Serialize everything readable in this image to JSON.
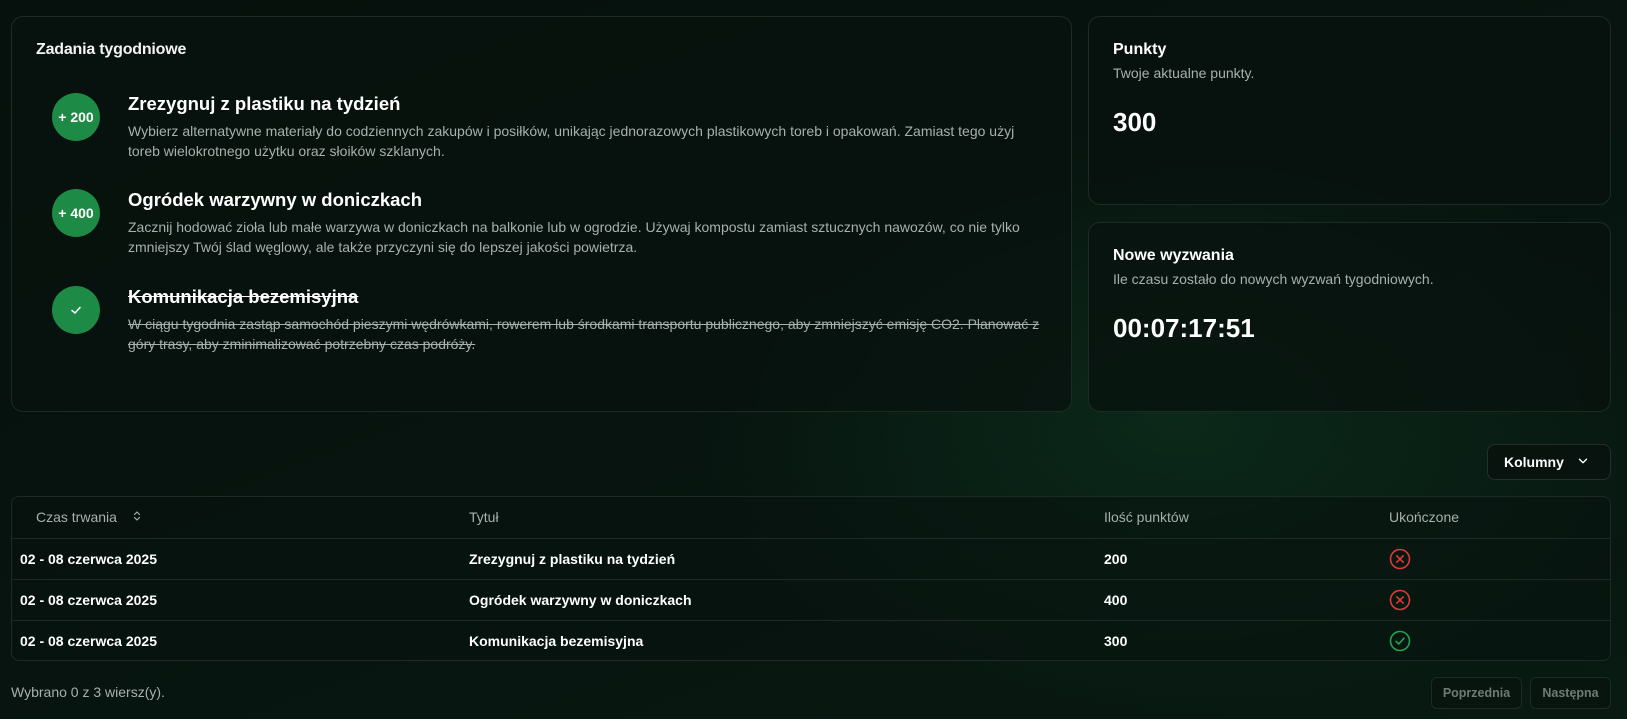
{
  "weekly_tasks": {
    "title": "Zadania tygodniowe",
    "items": [
      {
        "badge": "+ 200",
        "title": "Zrezygnuj z plastiku na tydzień",
        "description": "Wybierz alternatywne materiały do codziennych zakupów i posiłków, unikając jednorazowych plastikowych toreb i opakowań. Zamiast tego użyj toreb wielokrotnego użytku oraz słoików szklanych.",
        "completed": false
      },
      {
        "badge": "+ 400",
        "title": "Ogródek warzywny w doniczkach",
        "description": "Zacznij hodować zioła lub małe warzywa w doniczkach na balkonie lub w ogrodzie. Używaj kompostu zamiast sztucznych nawozów, co nie tylko zmniejszy Twój ślad węglowy, ale także przyczyni się do lepszej jakości powietrza.",
        "completed": false
      },
      {
        "badge_icon": "check-icon",
        "title": "Komunikacja bezemisyjna",
        "description": "W ciągu tygodnia zastąp samochód pieszymi wędrówkami, rowerem lub środkami transportu publicznego, aby zmniejszyć emisję CO2. Planować z góry trasy, aby zminimalizować potrzebny czas podróży.",
        "completed": true
      }
    ]
  },
  "points": {
    "title": "Punkty",
    "subtitle": "Twoje aktualne punkty.",
    "value": "300"
  },
  "new_challenges": {
    "title": "Nowe wyzwania",
    "subtitle": "Ile czasu zostało do nowych wyzwań tygodniowych.",
    "countdown": "00:07:17:51"
  },
  "columns_button": {
    "label": "Kolumny",
    "icon": "chevron-down-icon"
  },
  "table": {
    "headers": {
      "duration": "Czas trwania",
      "title": "Tytuł",
      "points": "Ilość punktów",
      "completed": "Ukończone"
    },
    "rows": [
      {
        "duration": "02 - 08 czerwca 2025",
        "title": "Zrezygnuj z plastiku na tydzień",
        "points": "200",
        "completed": false,
        "status_icon": "x-circle-icon"
      },
      {
        "duration": "02 - 08 czerwca 2025",
        "title": "Ogródek warzywny w doniczkach",
        "points": "400",
        "completed": false,
        "status_icon": "x-circle-icon"
      },
      {
        "duration": "02 - 08 czerwca 2025",
        "title": "Komunikacja bezemisyjna",
        "points": "300",
        "completed": true,
        "status_icon": "check-circle-icon"
      }
    ]
  },
  "footer": {
    "selection_text": "Wybrano 0 z 3 wiersz(y).",
    "prev_label": "Poprzednia",
    "next_label": "Następna"
  },
  "colors": {
    "accent_green": "#1d8a45",
    "status_red": "#d93b3b",
    "status_green": "#22a34f",
    "background": "#07140f"
  }
}
